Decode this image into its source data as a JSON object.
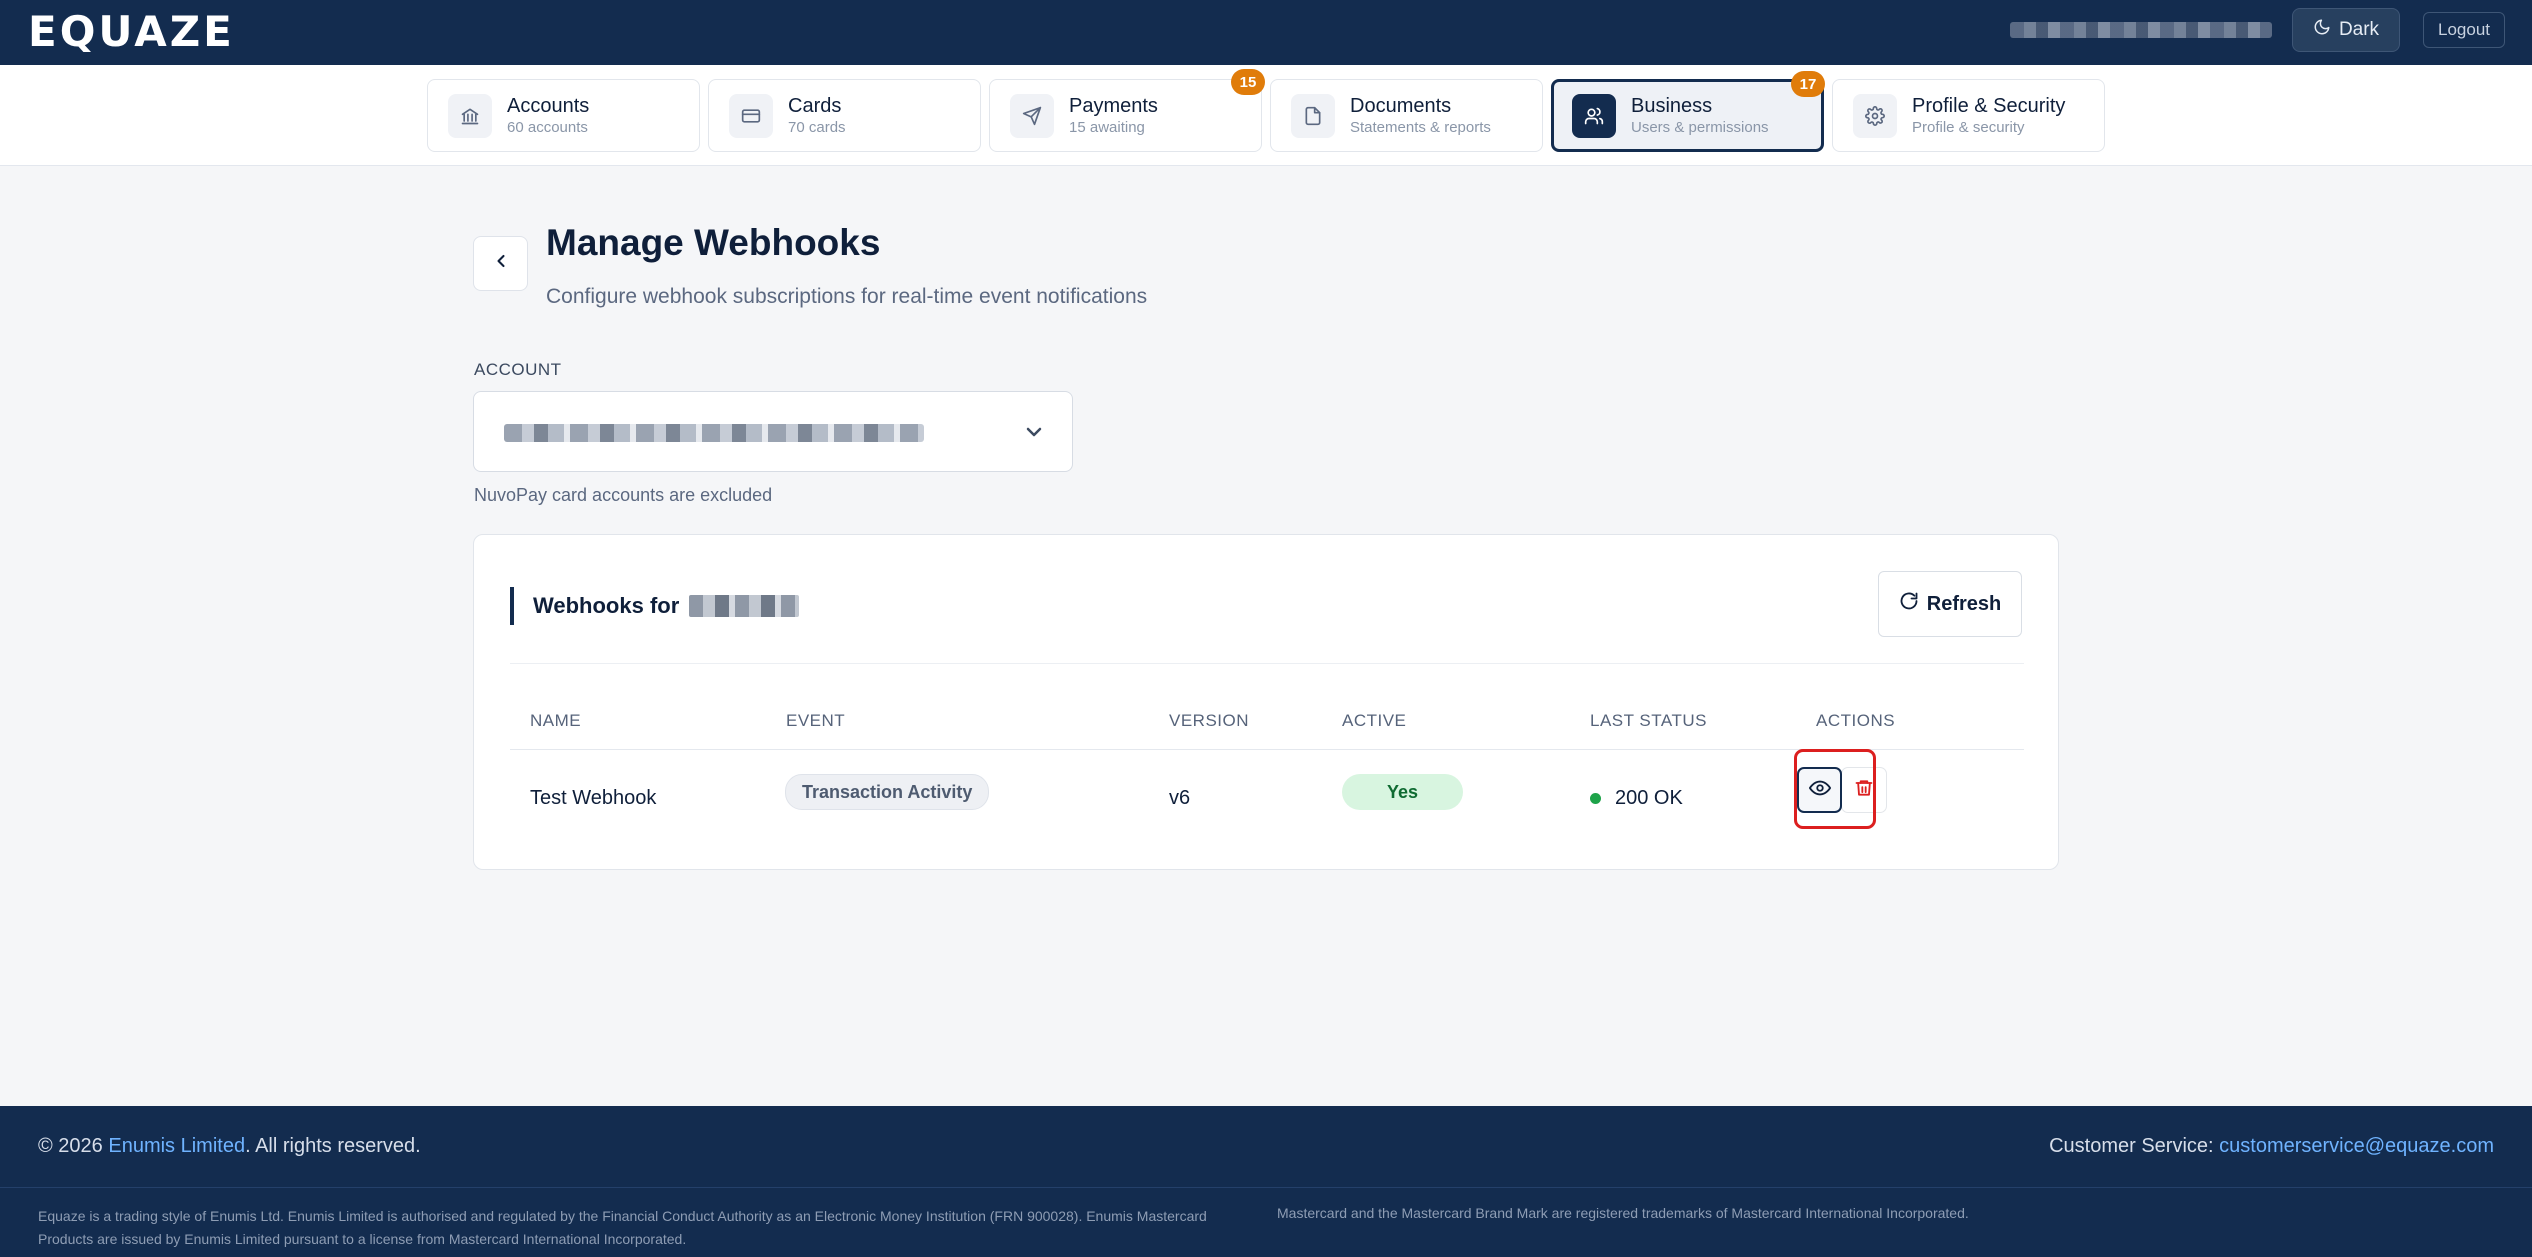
{
  "header": {
    "logo": "EQUAZE",
    "theme_button_label": "Dark",
    "logout_label": "Logout"
  },
  "nav": {
    "tabs": [
      {
        "title": "Accounts",
        "subtitle": "60 accounts",
        "icon": "bank-icon"
      },
      {
        "title": "Cards",
        "subtitle": "70 cards",
        "icon": "credit-card-icon"
      },
      {
        "title": "Payments",
        "subtitle": "15 awaiting",
        "badge": "15",
        "icon": "send-icon"
      },
      {
        "title": "Documents",
        "subtitle": "Statements & reports",
        "icon": "document-icon"
      },
      {
        "title": "Business",
        "subtitle": "Users & permissions",
        "badge": "17",
        "icon": "users-icon",
        "active": true
      },
      {
        "title": "Profile & Security",
        "subtitle": "Profile & security",
        "icon": "gear-icon"
      }
    ]
  },
  "page": {
    "title": "Manage Webhooks",
    "subtitle": "Configure webhook subscriptions for real-time event notifications"
  },
  "account": {
    "label": "ACCOUNT",
    "note": "NuvoPay card accounts are excluded"
  },
  "webhooks": {
    "title_prefix": "Webhooks for",
    "refresh_label": "Refresh",
    "columns": [
      "NAME",
      "EVENT",
      "VERSION",
      "ACTIVE",
      "LAST STATUS",
      "ACTIONS"
    ],
    "rows": [
      {
        "name": "Test Webhook",
        "event": "Transaction Activity",
        "version": "v6",
        "active": "Yes",
        "last_status": "200 OK"
      }
    ]
  },
  "footer": {
    "copyright_prefix": "© 2026",
    "company_link": "Enumis Limited",
    "copyright_suffix": ". All rights reserved.",
    "customer_service_label": "Customer Service:",
    "customer_service_email": "customerservice@equaze.com",
    "legal_text": "Equaze is a trading style of Enumis Ltd. Enumis Limited is authorised and regulated by the Financial Conduct Authority as an Electronic Money Institution (FRN 900028). Enumis Mastercard Products are issued by Enumis Limited pursuant to a license from Mastercard International Incorporated.",
    "mastercard_text": "Mastercard and the Mastercard Brand Mark are registered trademarks of Mastercard International Incorporated."
  },
  "colors": {
    "brand_navy": "#132c4f",
    "badge_orange": "#e07c0a",
    "success_green": "#1ea34a",
    "danger_red": "#dc1f1f",
    "link_blue": "#6fb3ff"
  }
}
